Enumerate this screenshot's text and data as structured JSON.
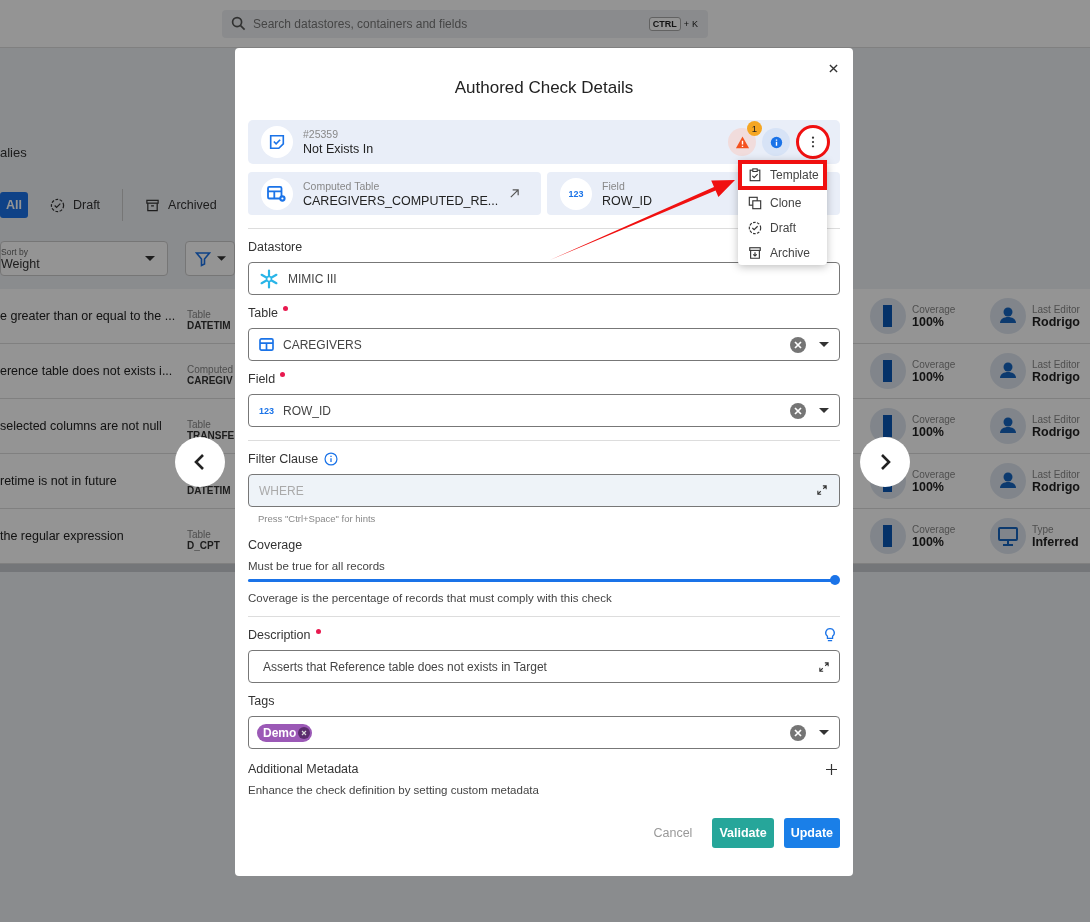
{
  "search": {
    "placeholder": "Search datastores, containers and fields",
    "keys": [
      "CTRL",
      "+",
      "K"
    ]
  },
  "page": {
    "heading": "alies",
    "tabs": [
      {
        "label": "All",
        "selected": true
      },
      {
        "label": "Draft",
        "selected": false
      },
      {
        "label": "Archived",
        "selected": false
      }
    ],
    "sort": {
      "label": "Sort by",
      "value": "Weight"
    },
    "rows": [
      {
        "description": "e greater than or equal to the ...",
        "container_label": "Table",
        "container": "DATETIM",
        "coverage_label": "Coverage",
        "coverage": "100%",
        "kind": "editor",
        "meta_label": "Last Editor",
        "meta_value": "Rodrigo"
      },
      {
        "description": "erence table does not exists i...",
        "container_label": "Computed",
        "container": "CAREGIV",
        "coverage_label": "Coverage",
        "coverage": "100%",
        "kind": "editor",
        "meta_label": "Last Editor",
        "meta_value": "Rodrigo"
      },
      {
        "description": "selected columns are not null",
        "container_label": "Table",
        "container": "TRANSFE",
        "coverage_label": "Coverage",
        "coverage": "100%",
        "kind": "editor",
        "meta_label": "Last Editor",
        "meta_value": "Rodrigo"
      },
      {
        "description": "retime is not in future",
        "container": "DATETIM",
        "coverage_label": "Coverage",
        "coverage": "100%",
        "kind": "editor",
        "meta_label": "Last Editor",
        "meta_value": "Rodrigo"
      },
      {
        "description": "the regular expression",
        "container_label": "Table",
        "container": "D_CPT",
        "coverage_label": "Coverage",
        "coverage": "100%",
        "kind": "type",
        "meta_label": "Type",
        "meta_value": "Inferred"
      }
    ]
  },
  "modal": {
    "title": "Authored Check Details",
    "check": {
      "number": "#25359",
      "name": "Not Exists In",
      "alert_count": "1",
      "menu_highlighted": true
    },
    "cards": [
      {
        "kind": "table",
        "label": "Computed Table",
        "value": "CAREGIVERS_COMPUTED_RE..."
      },
      {
        "kind": "field",
        "label": "Field",
        "value": "ROW_ID",
        "icon_text": "123"
      }
    ],
    "menu": [
      {
        "label": "Template",
        "highlighted": true
      },
      {
        "label": "Clone",
        "highlighted": false
      },
      {
        "label": "Draft",
        "highlighted": false
      },
      {
        "label": "Archive",
        "highlighted": false
      }
    ],
    "fields": [
      {
        "kind": "datastore",
        "label": "Datastore",
        "required": false,
        "value": "MIMIC III",
        "clearable": false
      },
      {
        "kind": "table",
        "label": "Table",
        "required": true,
        "value": "CAREGIVERS",
        "clearable": true
      },
      {
        "kind": "field",
        "label": "Field",
        "required": true,
        "value": "ROW_ID",
        "icon_text": "123",
        "clearable": true
      }
    ],
    "filter": {
      "label": "Filter Clause",
      "placeholder": "WHERE",
      "hint": "Press \"Ctrl+Space\" for hints"
    },
    "coverage": {
      "label": "Coverage",
      "caption": "Must be true for all records",
      "level": 1,
      "help": "Coverage is the percentage of records that must comply with this check"
    },
    "description": {
      "label": "Description",
      "required": true,
      "value": "Asserts that Reference table does not exists in Target"
    },
    "tags": {
      "label": "Tags",
      "items": [
        {
          "label": "Demo",
          "color": "#9b59b6"
        }
      ]
    },
    "metadata": {
      "label": "Additional Metadata",
      "help": "Enhance the check definition by setting custom metadata"
    },
    "buttons": [
      {
        "kind": "text",
        "label": "Cancel"
      },
      {
        "kind": "secondary",
        "label": "Validate"
      },
      {
        "kind": "primary",
        "label": "Update"
      }
    ]
  }
}
